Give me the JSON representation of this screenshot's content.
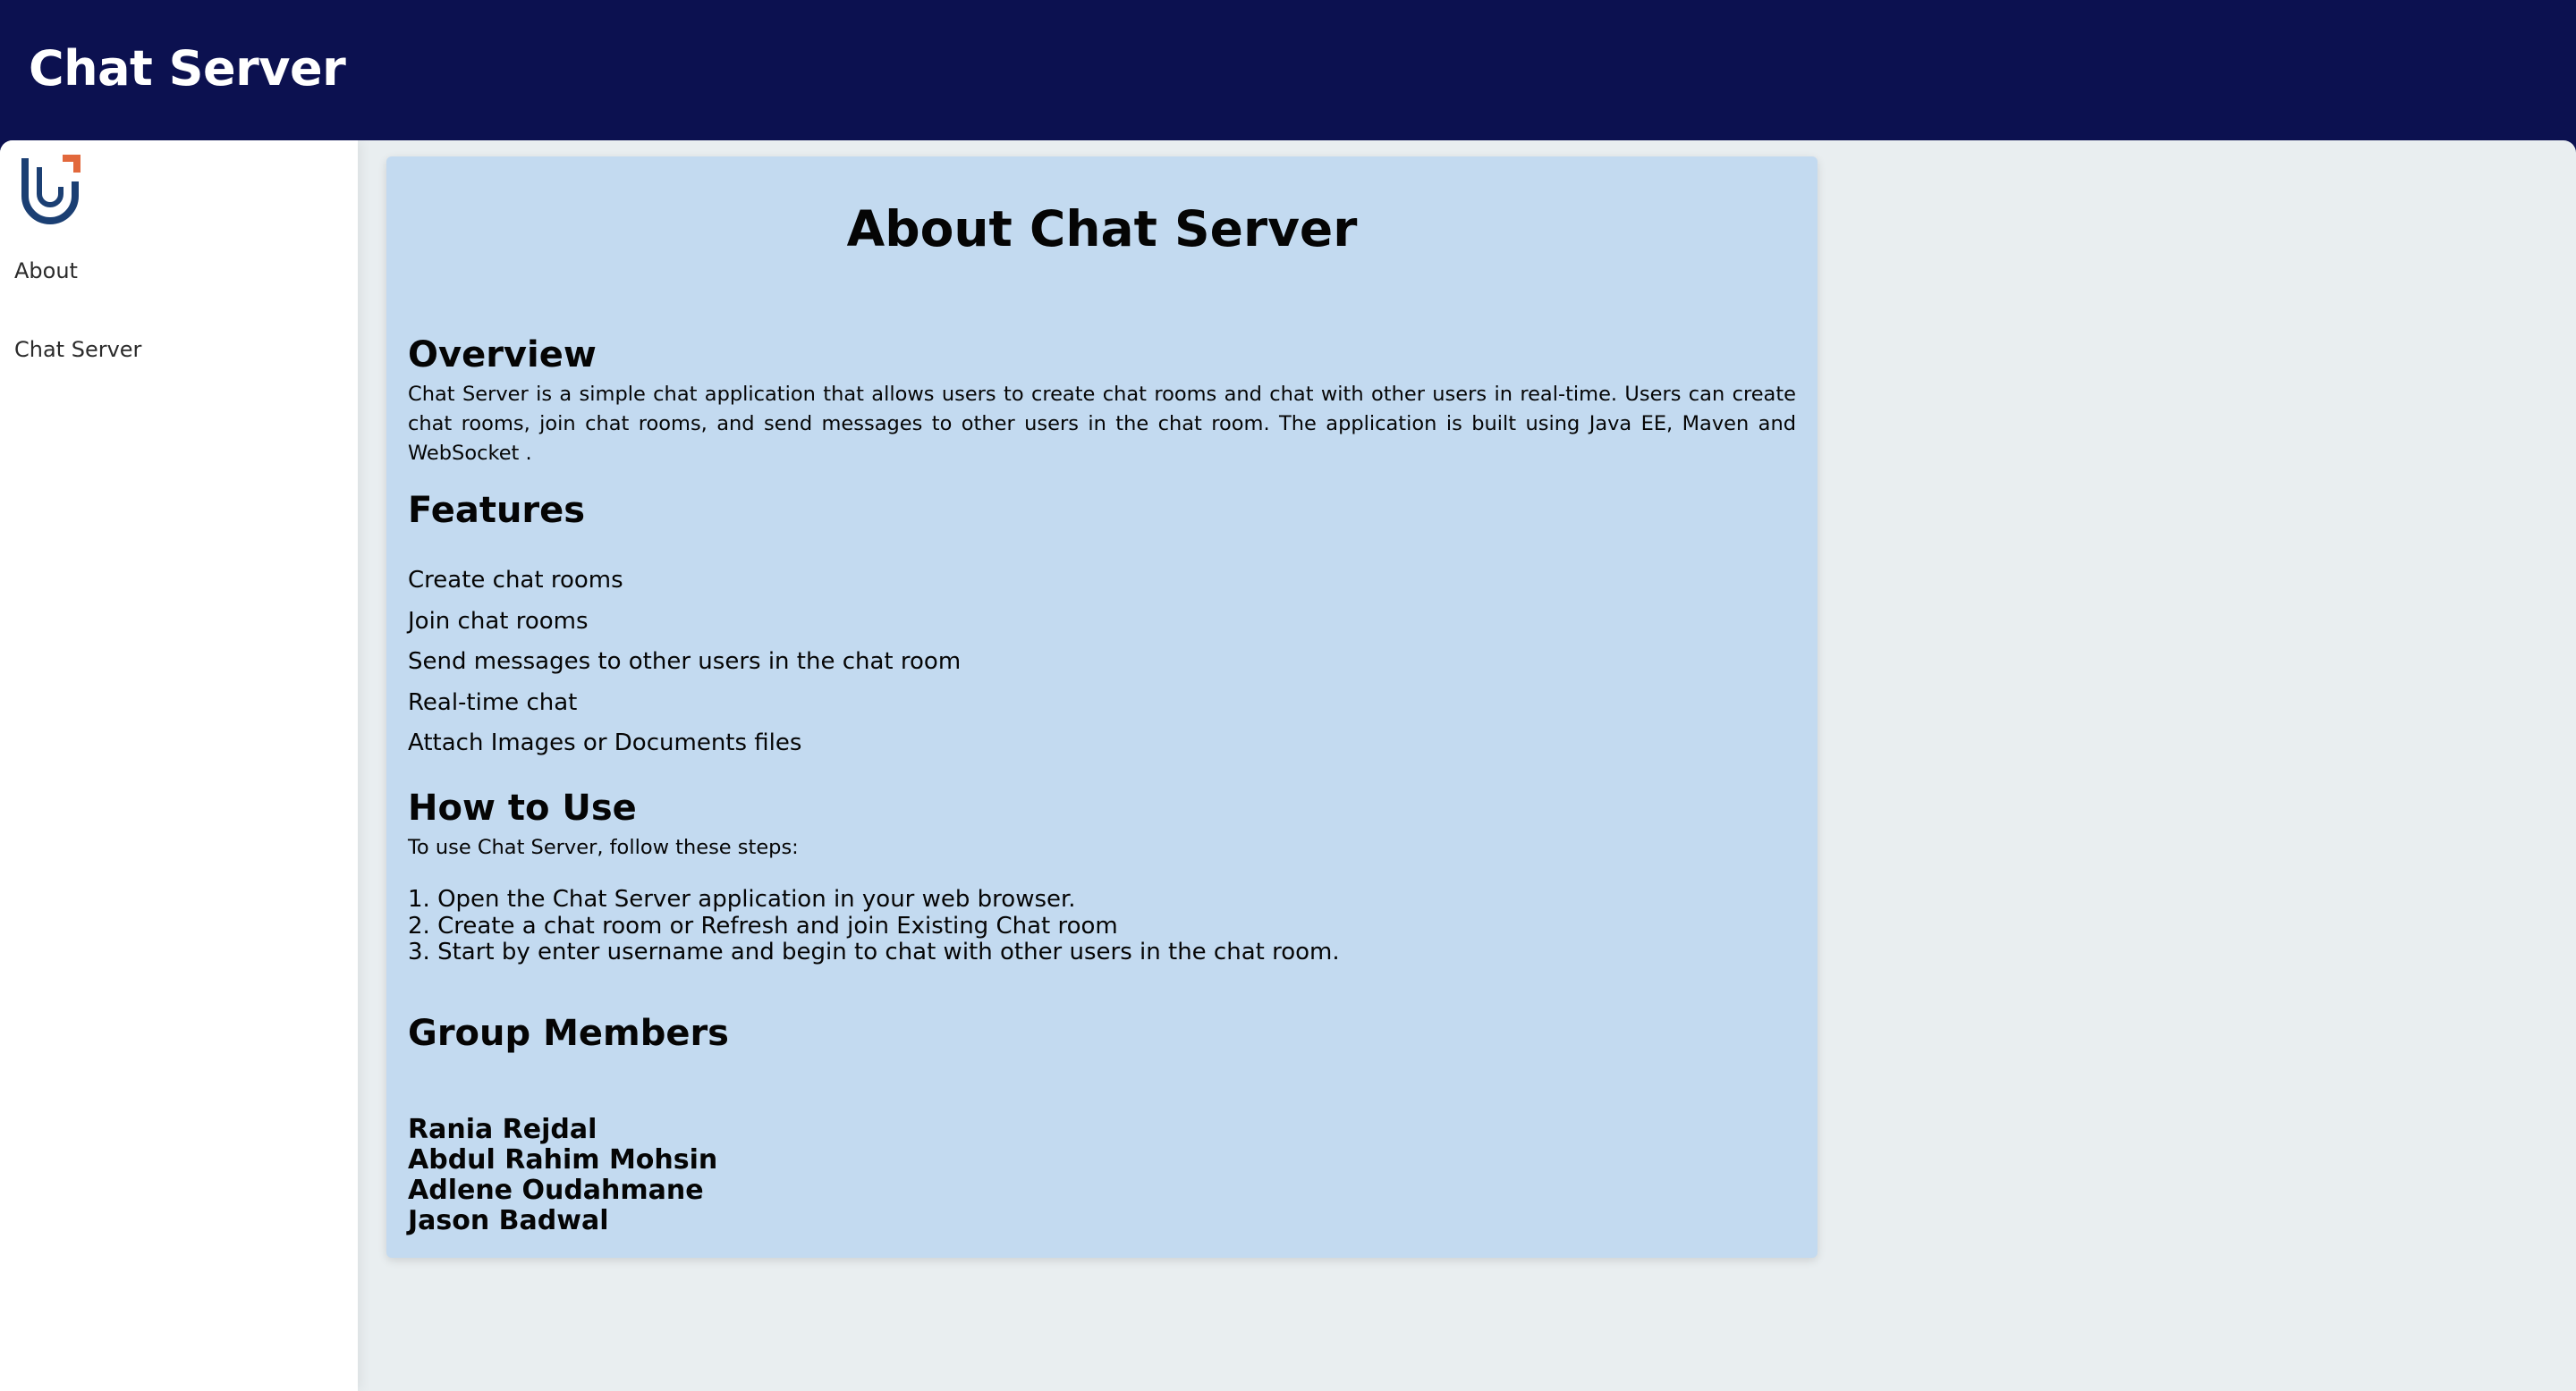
{
  "header": {
    "title": "Chat Server"
  },
  "sidebar": {
    "logo_icon": "brand-logo-icon",
    "items": [
      {
        "label": "About"
      },
      {
        "label": "Chat Server"
      }
    ]
  },
  "about": {
    "title": "About Chat Server",
    "overview": {
      "heading": "Overview",
      "text": "Chat Server is a simple chat application that allows users to create chat rooms and chat with other users in real-time. Users can create chat rooms, join chat rooms, and send messages to other users in the chat room. The application is built using Java EE, Maven and WebSocket ."
    },
    "features": {
      "heading": "Features",
      "items": [
        "Create chat rooms",
        "Join chat rooms",
        "Send messages to other users in the chat room",
        "Real-time chat",
        "Attach Images or Documents files"
      ]
    },
    "how_to_use": {
      "heading": "How to Use",
      "intro": "To use Chat Server, follow these steps:",
      "steps": [
        "1. Open the Chat Server application in your web browser.",
        "2. Create a chat room or Refresh and join Existing Chat room",
        "3. Start by enter username and begin to chat with other users in the chat room."
      ]
    },
    "group_members": {
      "heading": "Group Members",
      "names": [
        "Rania Rejdal",
        "Abdul Rahim Mohsin",
        "Adlene Oudahmane",
        "Jason Badwal"
      ]
    }
  },
  "colors": {
    "header_bg": "#0c1150",
    "card_bg": "#c3daf0",
    "page_bg": "#e9eef0",
    "logo_blue": "#1b3f73",
    "logo_orange": "#e2683c"
  }
}
